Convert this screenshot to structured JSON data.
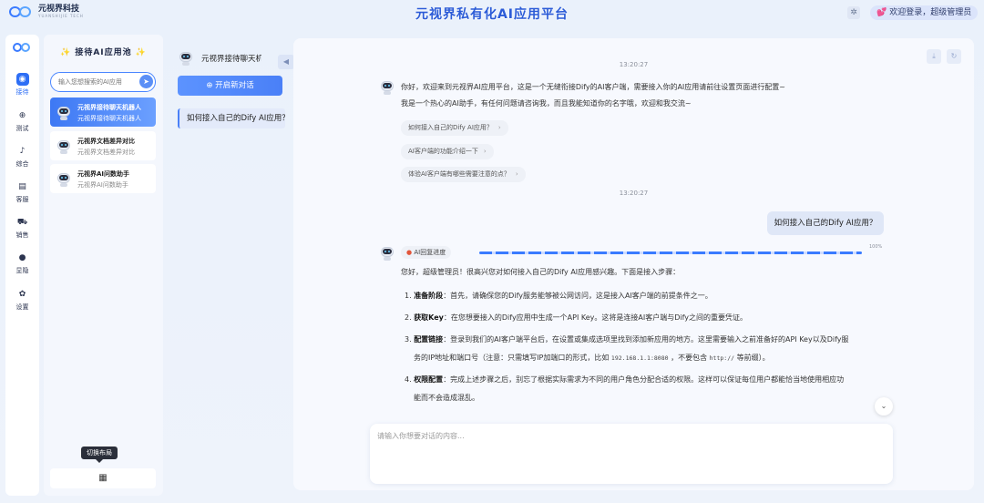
{
  "header": {
    "logo_text": "元视界科技",
    "logo_sub": "YUANSHIJIE TECH",
    "app_title": "元视界私有化AI应用平台",
    "login_text": "欢迎登录，超级管理员"
  },
  "rail": {
    "items": [
      {
        "label": "接待",
        "icon": "robot-icon",
        "active": true
      },
      {
        "label": "测试",
        "icon": "globe-icon",
        "active": false
      },
      {
        "label": "综合",
        "icon": "bell-icon",
        "active": false
      },
      {
        "label": "客服",
        "icon": "service-icon",
        "active": false
      },
      {
        "label": "销售",
        "icon": "cart-icon",
        "active": false
      },
      {
        "label": "显隐",
        "icon": "eye-icon",
        "active": false
      },
      {
        "label": "设置",
        "icon": "gear-icon",
        "active": false
      }
    ]
  },
  "pool": {
    "title": "接待AI应用池",
    "search_placeholder": "输入您想搜索的AI应用",
    "apps": [
      {
        "name": "元视界接待聊天机器人",
        "desc": "元视界接待聊天机器人",
        "active": true
      },
      {
        "name": "元视界文档差异对比",
        "desc": "元视界文档差异对比",
        "active": false
      },
      {
        "name": "元视界AI问数助手",
        "desc": "元视界AI问数助手",
        "active": false
      }
    ],
    "tooltip": "切换布局"
  },
  "session": {
    "title": "元视界接待聊天机器人",
    "new_chat": "开启新对话",
    "items": [
      "如何接入自己的Dify AI应用？"
    ]
  },
  "chat": {
    "time1": "13:20:27",
    "welcome_line1": "你好，欢迎来到元视界AI应用平台，这是一个无缝衔接Dify的AI客户端，需要接入你的AI应用请前往设置页面进行配置~",
    "welcome_line2": "我是一个热心的AI助手，有任何问题请咨询我，而且我能知道你的名字哦，欢迎和我交流~",
    "suggestions": [
      "如何接入自己的Dify AI应用？",
      "AI客户端的功能介绍一下",
      "体验AI客户端有哪些需要注意的点？"
    ],
    "time2": "13:20:27",
    "user_message": "如何接入自己的Dify AI应用？",
    "progress_label": "AI回复进度",
    "progress_pct": "100%",
    "progress_value": 1.0,
    "answer_intro": "您好，超级管理员！很高兴您对如何接入自己的Dify AI应用感兴趣。下面是接入步骤：",
    "steps": [
      {
        "num": "1.",
        "title": "准备阶段",
        "text": "：首先，请确保您的Dify服务能够被公网访问，这是接入AI客户端的前提条件之一。"
      },
      {
        "num": "2.",
        "title": "获取Key",
        "text": "：在您想要接入的Dify应用中生成一个API Key。这将是连接AI客户端与Dify之间的重要凭证。"
      },
      {
        "num": "3.",
        "title": "配置链接",
        "text": "：登录到我们的AI客户端平台后，在设置或集成选项里找到添加新应用的地方。这里需要输入之前准备好的API Key以及Dify服",
        "text2a": "务的IP地址和端口号（注意：只需填写IP加端口的形式，比如 ",
        "code1": "192.168.1.1:8080",
        "text2b": " ，不要包含 ",
        "code2": "http://",
        "text2c": " 等前缀）。"
      },
      {
        "num": "4.",
        "title": "权限配置",
        "text": "：完成上述步骤之后，别忘了根据实际需求为不同的用户角色分配合适的权限。这样可以保证每位用户都能恰当地使用相应功",
        "text2": "能而不会造成混乱。"
      }
    ],
    "composer_placeholder": "请输入你想要对话的内容..."
  }
}
